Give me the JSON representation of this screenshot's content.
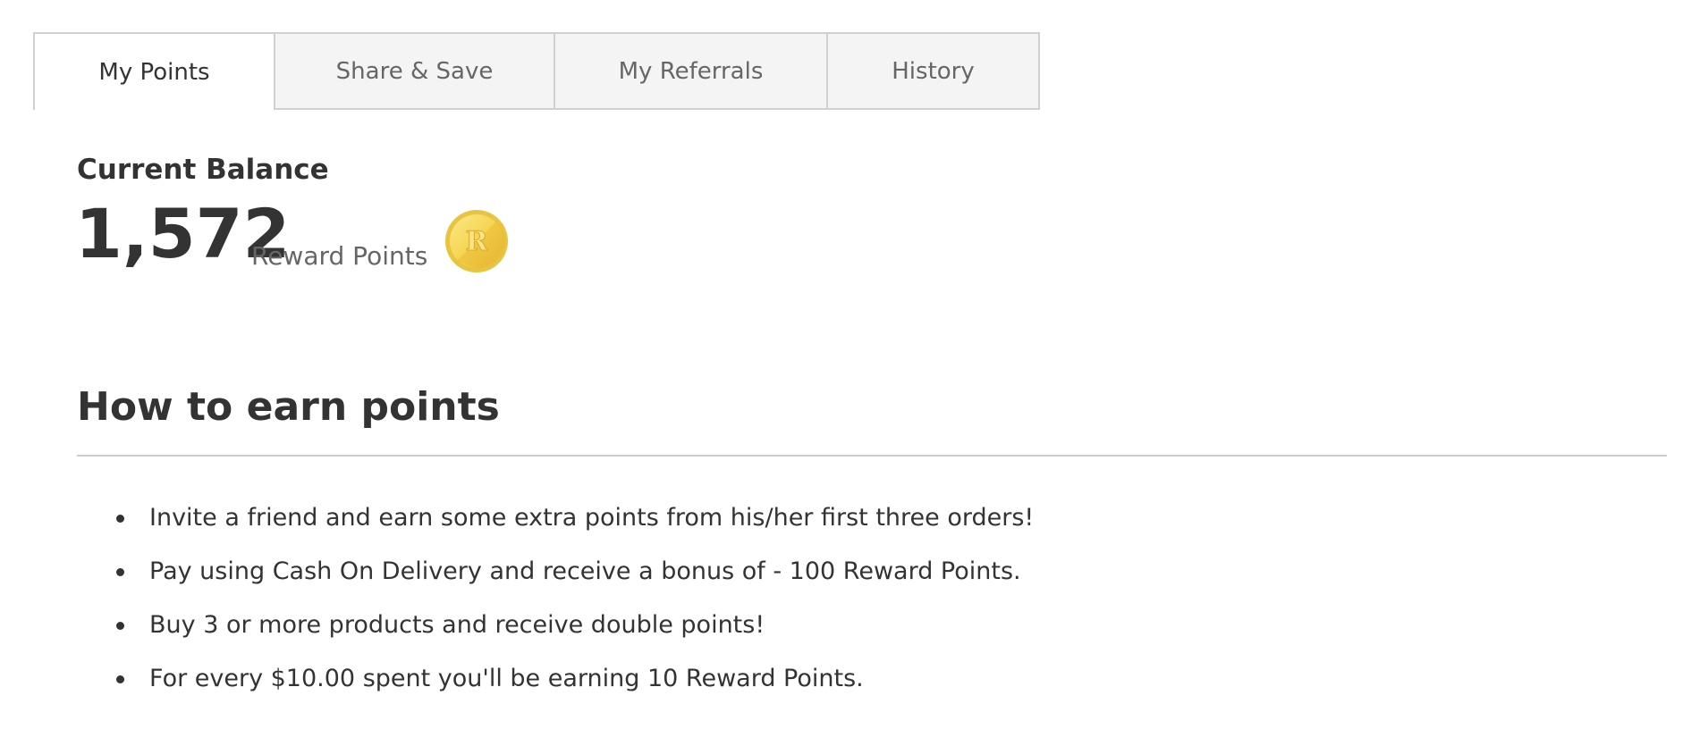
{
  "tabs": [
    {
      "label": "My Points",
      "active": true
    },
    {
      "label": "Share & Save",
      "active": false
    },
    {
      "label": "My Referrals",
      "active": false
    },
    {
      "label": "History",
      "active": false
    }
  ],
  "balance": {
    "label": "Current Balance",
    "value": "1,572",
    "unit": "Reward Points",
    "coin_letter": "R",
    "coin_icon": "reward-coin-icon"
  },
  "earn": {
    "title": "How to earn points",
    "items": [
      "Invite a friend and earn some extra points from his/her first three orders!",
      "Pay using Cash On Delivery and receive a bonus of - 100 Reward Points.",
      "Buy 3 or more products and receive double points!",
      "For every $10.00 spent you'll be earning 10 Reward Points."
    ]
  },
  "colors": {
    "text_primary": "#333333",
    "text_secondary": "#666666",
    "tab_inactive_bg": "#f4f4f4",
    "tab_border": "#d0d0d0",
    "coin_gold": "#f5d24a"
  }
}
